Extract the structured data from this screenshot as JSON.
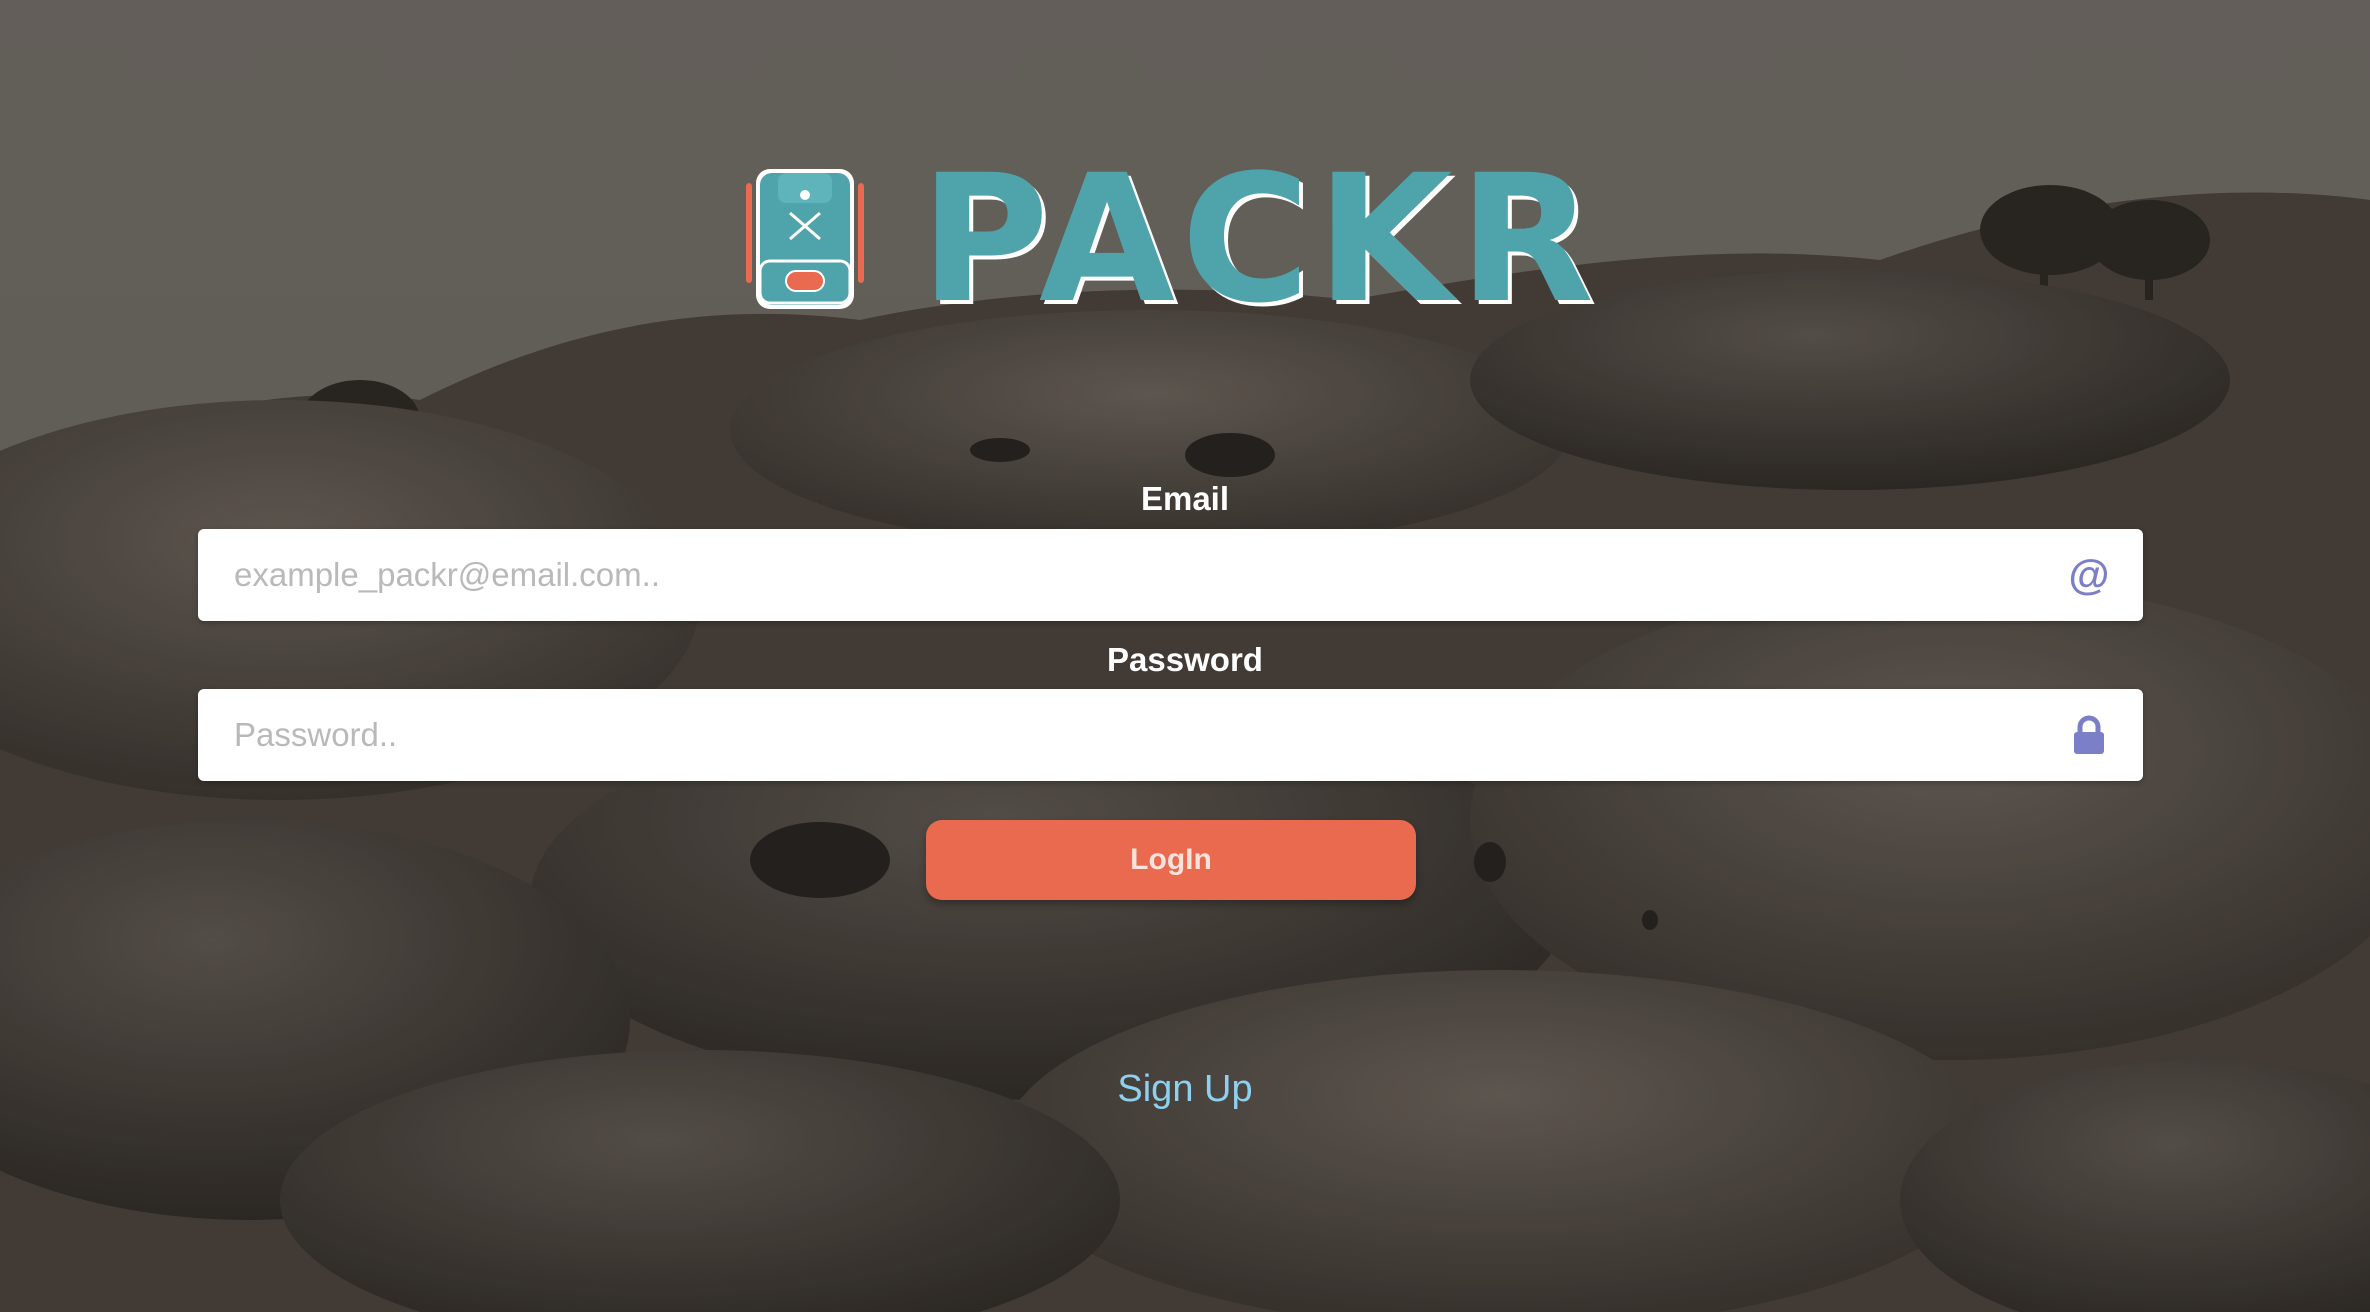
{
  "brand": {
    "name": "PACKR",
    "primary_color": "#4fa3ab",
    "accent_color": "#e96a4f",
    "logo_icon": "backpack-icon"
  },
  "form": {
    "email": {
      "label": "Email",
      "placeholder": "example_packr@email.com..",
      "icon": "at-icon"
    },
    "password": {
      "label": "Password",
      "placeholder": "Password..",
      "icon": "lock-icon"
    },
    "login_label": "LogIn",
    "signup_label": "Sign Up"
  },
  "colors": {
    "icon": "#7b7fc7",
    "link": "#8dd0f0",
    "label": "#ffffff"
  }
}
